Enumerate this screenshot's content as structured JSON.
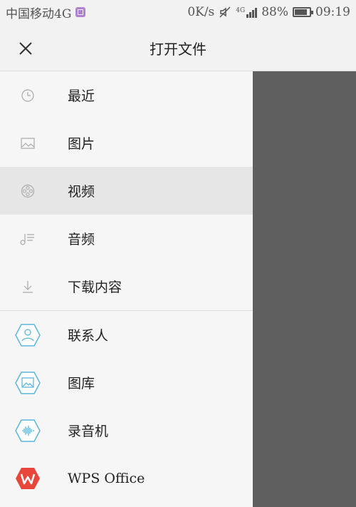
{
  "status_bar": {
    "carrier": "中国移动4G",
    "speed": "0K/s",
    "network_type": "4G",
    "battery": "88%",
    "battery_level": 0.88,
    "time": "09:19"
  },
  "header": {
    "title": "打开文件",
    "close_icon": "close-icon"
  },
  "locations": [
    {
      "label": "最近",
      "icon": "clock-icon"
    },
    {
      "label": "图片",
      "icon": "image-icon"
    },
    {
      "label": "视频",
      "icon": "video-reel-icon",
      "selected": true
    },
    {
      "label": "音频",
      "icon": "music-note-icon"
    },
    {
      "label": "下载内容",
      "icon": "download-icon"
    }
  ],
  "apps": [
    {
      "label": "联系人",
      "icon": "contacts-icon"
    },
    {
      "label": "图库",
      "icon": "gallery-icon"
    },
    {
      "label": "录音机",
      "icon": "recorder-icon"
    },
    {
      "label": "WPS Office",
      "icon": "wps-office-icon"
    }
  ],
  "colors": {
    "app_icon_outline": "#5bb6dc",
    "wps_red": "#e8463a",
    "overlay": "#5f5f5f"
  }
}
